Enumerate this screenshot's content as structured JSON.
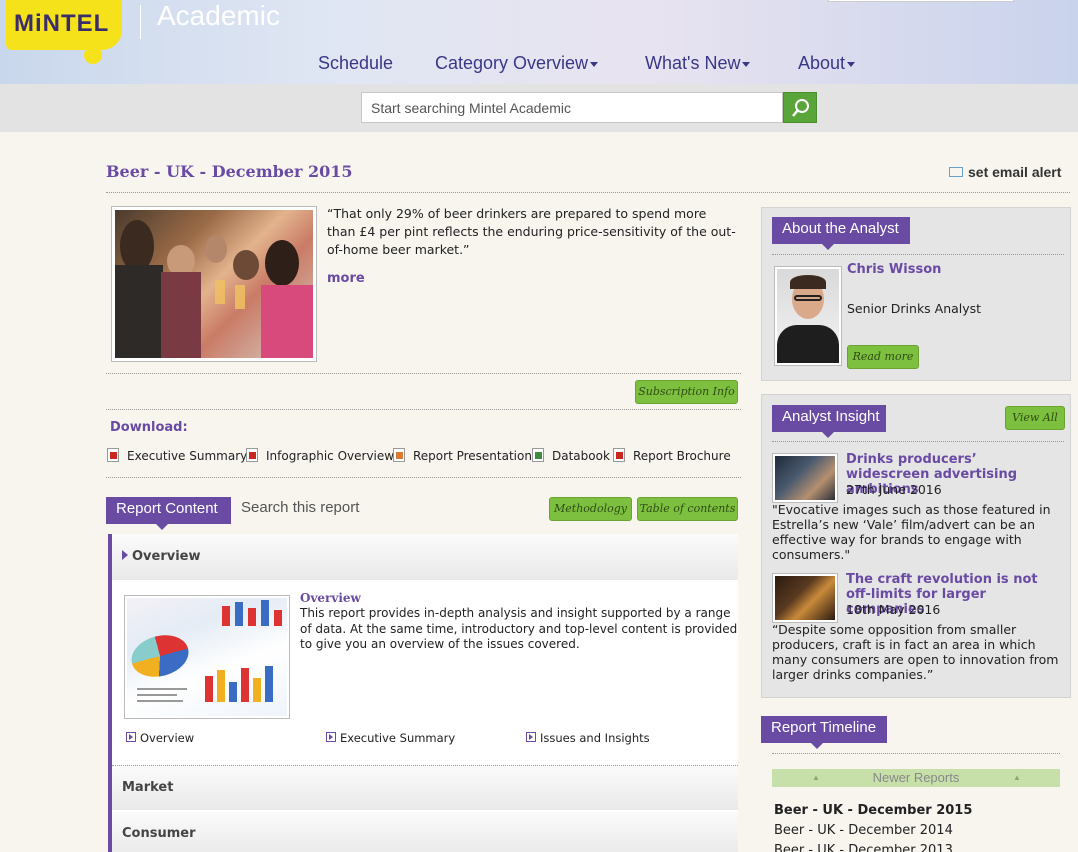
{
  "header": {
    "logo_text": "MiNTEL",
    "site_name": "Academic",
    "nav": [
      {
        "label": "Schedule",
        "dropdown": false
      },
      {
        "label": "Category Overview",
        "dropdown": true
      },
      {
        "label": "What's New",
        "dropdown": true
      },
      {
        "label": "About",
        "dropdown": true
      }
    ],
    "search_placeholder": "Start searching Mintel Academic"
  },
  "report": {
    "title": "Beer - UK - December 2015",
    "email_alert": "set email alert",
    "quote": "“That only 29% of beer drinkers are prepared to spend more than £4 per pint reflects the enduring price-sensitivity of the out-of-home beer market.”",
    "more": "more",
    "subscription_button": "Subscription Info",
    "download_label": "Download:",
    "downloads": [
      {
        "label": "Executive Summary",
        "icon": "pdf-icon"
      },
      {
        "label": "Infographic Overview",
        "icon": "pdf-icon"
      },
      {
        "label": "Report Presentation",
        "icon": "ppt-icon"
      },
      {
        "label": "Databook",
        "icon": "xls-icon"
      },
      {
        "label": "Report Brochure",
        "icon": "pdf-icon"
      }
    ]
  },
  "report_content": {
    "tab_label": "Report Content",
    "search_label": "Search this report",
    "methodology_button": "Methodology",
    "toc_button": "Table of contents",
    "sections": [
      "Overview",
      "Market",
      "Consumer"
    ],
    "overview_title": "Overview",
    "overview_text": "This report provides in-depth analysis and insight supported by a range of data. At the same time, introductory and top-level content is provided to give you an overview of the issues covered.",
    "sub_links": [
      "Overview",
      "Executive Summary",
      "Issues and Insights"
    ]
  },
  "analyst": {
    "heading": "About the Analyst",
    "name": "Chris Wisson",
    "role": "Senior Drinks Analyst",
    "read_more": "Read more"
  },
  "insight": {
    "heading": "Analyst Insight",
    "view_all": "View All",
    "items": [
      {
        "title": "Drinks producers’ widescreen advertising ambitions",
        "date": "27th June 2016",
        "quote": "\"Evocative images such as those featured in Estrella’s new ‘Vale’ film/advert can be an effective way for brands to engage with consumers.\""
      },
      {
        "title": "The craft revolution is not off-limits for larger companies",
        "date": "18th May 2016",
        "quote": "“Despite some opposition from smaller producers, craft is in fact an area in which many consumers are open to innovation from larger drinks companies.”"
      }
    ]
  },
  "timeline": {
    "heading": "Report Timeline",
    "newer_label": "Newer Reports",
    "items": [
      "Beer - UK - December 2015",
      "Beer - UK - December 2014",
      "Beer - UK - December 2013"
    ]
  }
}
